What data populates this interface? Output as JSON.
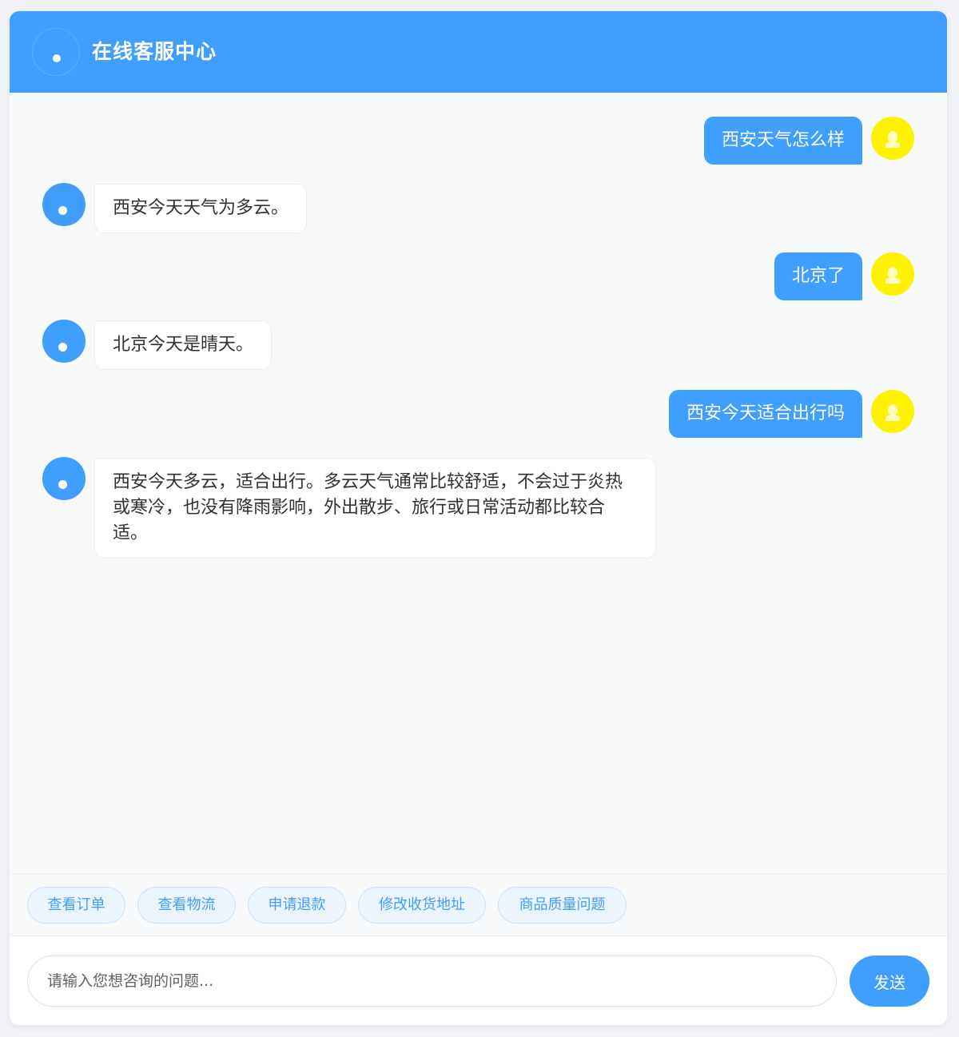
{
  "header": {
    "title": "在线客服中心"
  },
  "messages": [
    {
      "role": "user",
      "text": "西安天气怎么样"
    },
    {
      "role": "bot",
      "text": "西安今天天气为多云。"
    },
    {
      "role": "user",
      "text": "北京了"
    },
    {
      "role": "bot",
      "text": "北京今天是晴天。"
    },
    {
      "role": "user",
      "text": "西安今天适合出行吗"
    },
    {
      "role": "bot",
      "text": "西安今天多云，适合出行。多云天气通常比较舒适，不会过于炎热或寒冷，也没有降雨影响，外出散步、旅行或日常活动都比较合适。"
    }
  ],
  "quick_actions": [
    "查看订单",
    "查看物流",
    "申请退款",
    "修改收货地址",
    "商品质量问题"
  ],
  "input": {
    "placeholder": "请输入您想咨询的问题...",
    "value": ""
  },
  "send_label": "发送",
  "colors": {
    "primary": "#409eff",
    "user_avatar": "#fff200",
    "background": "#f8f9fa"
  },
  "icons": {
    "header_avatar": "bot-avatar-icon",
    "bot_avatar": "bot-avatar-icon",
    "user_avatar": "user-avatar-icon"
  }
}
